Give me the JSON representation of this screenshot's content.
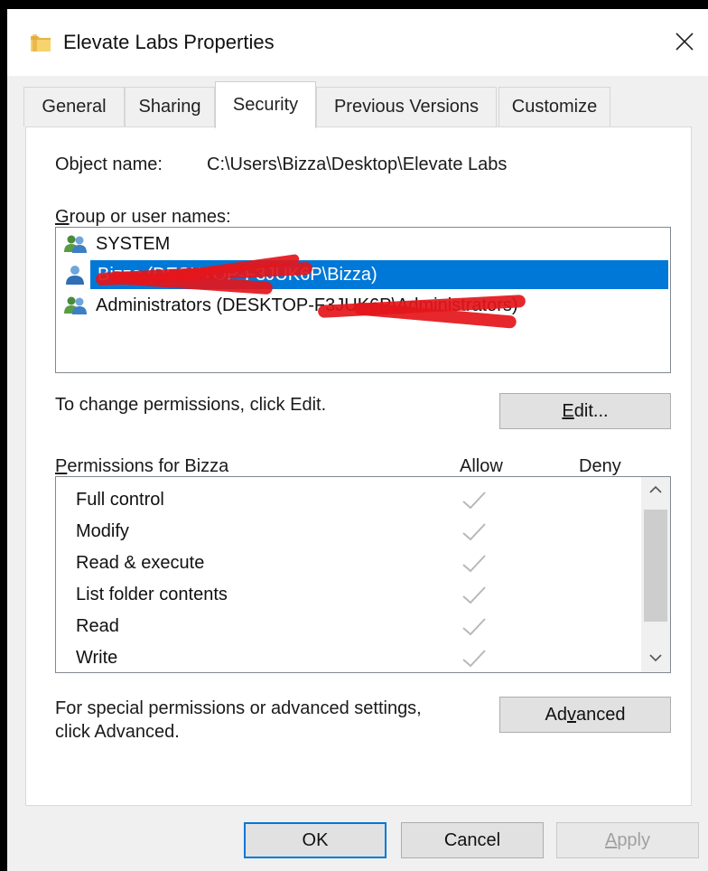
{
  "window": {
    "title": "Elevate Labs Properties",
    "close_symbol": "✕"
  },
  "tabs": [
    {
      "label": "General",
      "active": false
    },
    {
      "label": "Sharing",
      "active": false
    },
    {
      "label": "Security",
      "active": true
    },
    {
      "label": "Previous Versions",
      "active": false
    },
    {
      "label": "Customize",
      "active": false
    }
  ],
  "security": {
    "object_name_label": "Object name:",
    "object_name_value": "C:\\Users\\Bizza\\Desktop\\Elevate Labs",
    "group_label_accesskey": "G",
    "group_label_rest": "roup or user names:",
    "users": [
      {
        "name": "SYSTEM",
        "icon": "group-users-icon",
        "selected": false
      },
      {
        "name": "Bizza (DESKTOP-F3JUK6P\\Bizza)",
        "icon": "user-icon",
        "selected": true
      },
      {
        "name": "Administrators (DESKTOP-F3JUK6P\\Administrators)",
        "icon": "group-users-icon",
        "selected": false
      }
    ],
    "change_hint": "To change permissions, click Edit.",
    "edit_button_accesskey": "E",
    "edit_button_rest": "dit...",
    "permissions_label_accesskey": "P",
    "permissions_label_rest": "ermissions for Bizza",
    "allow_header": "Allow",
    "deny_header": "Deny",
    "permissions": [
      {
        "name": "Full control",
        "allow": true,
        "deny": false
      },
      {
        "name": "Modify",
        "allow": true,
        "deny": false
      },
      {
        "name": "Read & execute",
        "allow": true,
        "deny": false
      },
      {
        "name": "List folder contents",
        "allow": true,
        "deny": false
      },
      {
        "name": "Read",
        "allow": true,
        "deny": false
      },
      {
        "name": "Write",
        "allow": true,
        "deny": false
      }
    ],
    "advanced_hint_line1": "For special permissions or advanced settings,",
    "advanced_hint_line2": "click Advanced.",
    "advanced_button_pre": "Ad",
    "advanced_button_accesskey": "v",
    "advanced_button_post": "anced"
  },
  "footer": {
    "ok_label": "OK",
    "cancel_label": "Cancel",
    "apply_label_accesskey": "A",
    "apply_label_rest": "pply"
  },
  "colors": {
    "selection": "#0078d7",
    "redaction": "#e4161b",
    "check_disabled": "#b8b8b8",
    "folder": "#f2c94c"
  }
}
